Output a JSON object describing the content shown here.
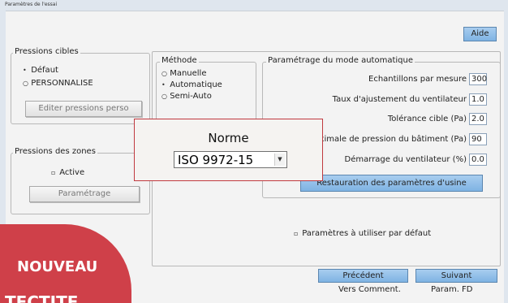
{
  "window": {
    "title": "Paramètres de l'essai"
  },
  "aide_label": "Aide",
  "pressions_cibles": {
    "title": "Pressions cibles",
    "options": [
      "Défaut",
      "PERSONNALISE"
    ],
    "editer_label": "Editer pressions perso"
  },
  "pressions_zones": {
    "title": "Pressions des zones",
    "active_label": "Active",
    "parametrage_label": "Paramétrage"
  },
  "methode": {
    "title": "Méthode",
    "options": [
      "Manuelle",
      "Automatique",
      "Semi-Auto"
    ]
  },
  "auto": {
    "title": "Paramétrage du mode automatique",
    "rows": [
      {
        "label": "Echantillons par mesure",
        "value": "300"
      },
      {
        "label": "Taux d'ajustement du ventilateur",
        "value": "1.0"
      },
      {
        "label": "Tolérance cible (Pa)",
        "value": "2.0"
      },
      {
        "label": "aximale de pression du bâtiment (Pa)",
        "value": "90"
      },
      {
        "label": "Démarrage du ventilateur (%)",
        "value": "0.0"
      }
    ],
    "restore_label": "Restauration des paramètres d'usine"
  },
  "defaults_label": "Paramètres à utiliser par défaut",
  "norme": {
    "title": "Norme",
    "selected": "ISO 9972-15"
  },
  "precedent": {
    "label": "Précédent",
    "sub": "Vers Comment."
  },
  "suivant": {
    "label": "Suivant",
    "sub": "Param. FD"
  },
  "badge": {
    "line1": "NOUVEAU",
    "line2": "TECTITE"
  },
  "colors": {
    "accent_red": "#cf4049",
    "button_blue": "#8fbde8"
  }
}
